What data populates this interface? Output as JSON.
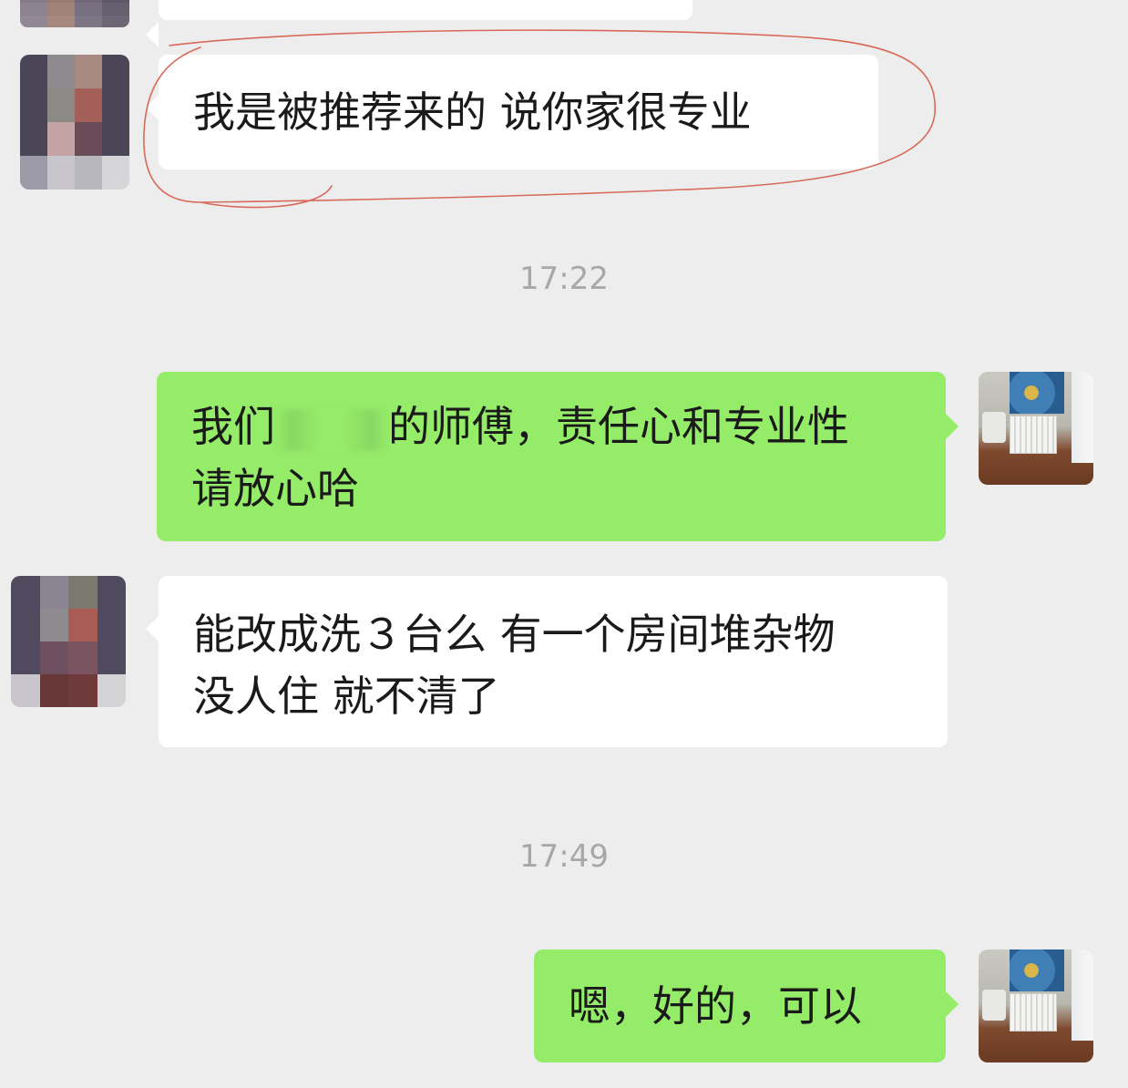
{
  "messages": [
    {
      "side": "left",
      "lines": [
        "我是被推荐来的 说你家很专业"
      ]
    },
    {
      "type": "timestamp",
      "text": "17:22"
    },
    {
      "side": "right",
      "lines": [
        "我们",
        "的师傅，责任心和专业性",
        "请放心哈"
      ]
    },
    {
      "side": "left",
      "lines": [
        "能改成洗３台么 有一个房间堆杂物",
        "没人住 就不清了"
      ]
    },
    {
      "type": "timestamp",
      "text": "17:49"
    },
    {
      "side": "right",
      "lines": [
        "嗯，好的，可以"
      ]
    }
  ],
  "colors": {
    "background": "#ededed",
    "incoming_bubble": "#ffffff",
    "outgoing_bubble": "#95ec69",
    "timestamp": "#a8a8a8",
    "annotation": "#d86a5a"
  }
}
